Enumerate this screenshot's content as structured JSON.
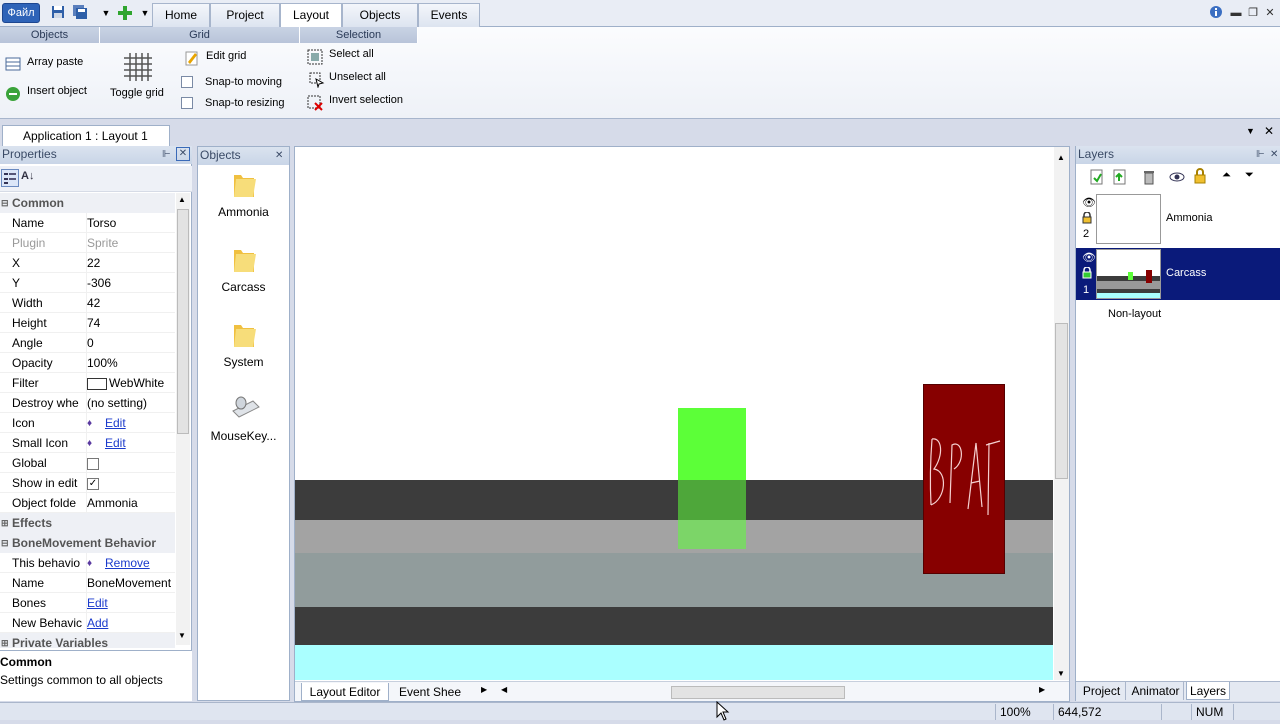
{
  "titlebar": {
    "file_button": "Файл",
    "tabs": [
      "Home",
      "Project",
      "Layout",
      "Objects",
      "Events"
    ],
    "active_tab": "Layout"
  },
  "ribbon": {
    "groups": [
      "Objects",
      "Grid",
      "Selection"
    ],
    "array_paste": "Array paste",
    "insert_object": "Insert object",
    "toggle_grid": "Toggle grid",
    "edit_grid": "Edit grid",
    "snap_moving": "Snap-to moving",
    "snap_resizing": "Snap-to resizing",
    "select_all": "Select all",
    "unselect_all": "Unselect all",
    "invert_selection": "Invert selection"
  },
  "document_tab": "Application 1 : Layout 1",
  "properties": {
    "title": "Properties",
    "rows": [
      {
        "type": "cat",
        "label": "Common"
      },
      {
        "type": "row",
        "name": "Name",
        "value": "Torso"
      },
      {
        "type": "row",
        "name": "Plugin",
        "value": "Sprite",
        "disabled": true
      },
      {
        "type": "row",
        "name": "X",
        "value": "22"
      },
      {
        "type": "row",
        "name": "Y",
        "value": "-306"
      },
      {
        "type": "row",
        "name": "Width",
        "value": "42"
      },
      {
        "type": "row",
        "name": "Height",
        "value": "74"
      },
      {
        "type": "row",
        "name": "Angle",
        "value": "0"
      },
      {
        "type": "row",
        "name": "Opacity",
        "value": "100%"
      },
      {
        "type": "row",
        "name": "Filter",
        "value": "WebWhite",
        "swatch": true
      },
      {
        "type": "row",
        "name": "Destroy whe",
        "value": "(no setting)"
      },
      {
        "type": "row",
        "name": "Icon",
        "value": "Edit",
        "link": true,
        "icon": true
      },
      {
        "type": "row",
        "name": "Small Icon",
        "value": "Edit",
        "link": true,
        "icon": true
      },
      {
        "type": "row",
        "name": "Global",
        "value": "",
        "checkbox": false
      },
      {
        "type": "row",
        "name": "Show in edit",
        "value": "",
        "checkbox": true
      },
      {
        "type": "row",
        "name": "Object folde",
        "value": "Ammonia"
      },
      {
        "type": "cat",
        "label": "Effects",
        "expand": true
      },
      {
        "type": "cat",
        "label": "BoneMovement Behavior"
      },
      {
        "type": "row",
        "name": "This behavio",
        "value": "Remove",
        "link": true,
        "icon": true
      },
      {
        "type": "row",
        "name": "Name",
        "value": "BoneMovement"
      },
      {
        "type": "row",
        "name": "Bones",
        "value": "Edit",
        "link": true
      },
      {
        "type": "row",
        "name": "New Behavic",
        "value": "Add",
        "link": true
      },
      {
        "type": "cat",
        "label": "Private Variables",
        "expand": true
      }
    ],
    "desc_title": "Common",
    "desc_text": "Settings common to all objects"
  },
  "objects": {
    "title": "Objects",
    "items": [
      "Ammonia",
      "Carcass",
      "System",
      "MouseKey..."
    ]
  },
  "canvas": {
    "enemy_text": "ВРАГ",
    "bottom_tabs": [
      "Layout Editor",
      "Event Shee"
    ]
  },
  "layers": {
    "title": "Layers",
    "items": [
      {
        "name": "Ammonia",
        "index": "2",
        "selected": false
      },
      {
        "name": "Carcass",
        "index": "1",
        "selected": true
      }
    ],
    "nonlayout": "Non-layout",
    "bottom_tabs": [
      "Project",
      "Animator",
      "Layers"
    ],
    "active_bottom": "Layers"
  },
  "statusbar": {
    "zoom": "100%",
    "coords": "644,572",
    "num": "NUM"
  },
  "colors": {
    "green_sprite": "#5cff38",
    "enemy": "#870000",
    "cyan_floor": "#aaffff",
    "selection": "#0a1a7a"
  }
}
